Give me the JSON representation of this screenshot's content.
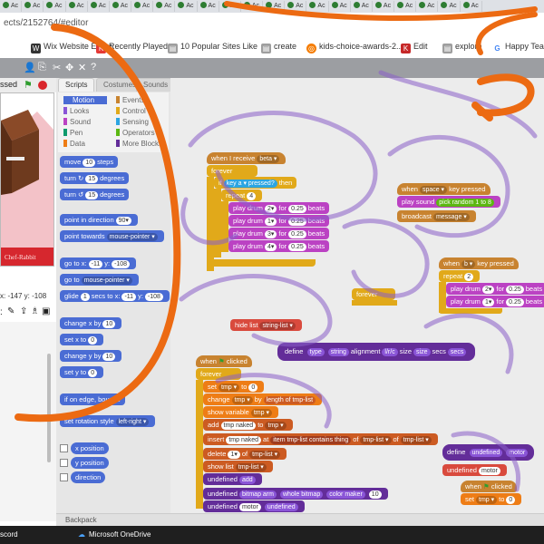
{
  "browser": {
    "tabs": [
      "Ac",
      "Ac",
      "Ac",
      "Ac",
      "Ac",
      "Ac",
      "Ac",
      "Ac",
      "Ac",
      "Ac",
      "Ac",
      "Ac",
      "Ac",
      "Ac",
      "Ac",
      "Ac",
      "Ac",
      "Ac",
      "Ac",
      "Ac",
      "Ac",
      "Ac"
    ],
    "url": "ects/2152764/#editor",
    "bookmarks": [
      "Wix Website Editor",
      "Recently Played »",
      "10 Popular Sites Like",
      "create",
      "kids-choice-awards-2...",
      "Edit",
      "explore",
      "Happy Teach"
    ]
  },
  "stage": {
    "name": "ssed",
    "coords": "x: -147  y: -108"
  },
  "palette": {
    "tabs": [
      "Scripts",
      "Costumes",
      "Sounds"
    ],
    "categories": [
      "Motion",
      "Looks",
      "Sound",
      "Pen",
      "Data",
      "Events",
      "Control",
      "Sensing",
      "Operators",
      "More Blocks"
    ],
    "blocks": {
      "move": "move",
      "move_val": "10",
      "move_tail": "steps",
      "turn_r": "turn ↻",
      "turn_r_val": "15",
      "turn_r_tail": "degrees",
      "turn_l": "turn ↺",
      "turn_l_val": "15",
      "turn_l_tail": "degrees",
      "point_dir": "point in direction",
      "point_dir_val": "90▾",
      "point_towards": "point towards",
      "point_towards_val": "mouse-pointer ▾",
      "goto_xy": "go to x:",
      "goto_xy_x": "-11",
      "goto_xy_y_label": "y:",
      "goto_xy_y": "-108",
      "goto": "go to",
      "goto_val": "mouse-pointer ▾",
      "glide": "glide",
      "glide_secs": "1",
      "glide_mid": "secs to x:",
      "glide_x": "-11",
      "glide_y_label": "y:",
      "glide_y": "-108",
      "change_x": "change x by",
      "change_x_val": "10",
      "set_x": "set x to",
      "set_x_val": "0",
      "change_y": "change y by",
      "change_y_val": "10",
      "set_y": "set y to",
      "set_y_val": "0",
      "bounce": "if on edge, bounce",
      "rot_style": "set rotation style",
      "rot_style_val": "left-right ▾",
      "xpos": "x position",
      "ypos": "y position",
      "direction": "direction"
    },
    "backpack": "Backpack"
  },
  "scripts": {
    "s1": {
      "hat": "when I receive",
      "hat_val": "beta ▾",
      "forever": "forever",
      "if": "if",
      "key": "key",
      "key_val": "a ▾",
      "pressed": "pressed?",
      "then": "then",
      "repeat": "repeat",
      "repeat_val": "4",
      "play": "play drum",
      "for": "for",
      "beats_val": "0.25",
      "beats": "beats",
      "drums": [
        "2▾",
        "1▾",
        "3▾",
        "4▾"
      ]
    },
    "s2": {
      "hat": "when",
      "hat_key": "space ▾",
      "hat_tail": "key pressed",
      "play_sound": "play sound",
      "pick": "pick random",
      "pick_a": "1",
      "pick_to": "to",
      "pick_b": "8",
      "broadcast": "broadcast",
      "broadcast_val": "message ▾"
    },
    "s3": {
      "hat": "when",
      "hat_key": "b ▾",
      "hat_tail": "key pressed",
      "repeat": "repeat",
      "repeat_val": "2",
      "play": "play drum",
      "drums": [
        "2▾",
        "1▾"
      ],
      "for": "for",
      "beats_val": "0.25",
      "beats": "beats"
    },
    "forever_loose": "forever",
    "hide_list": "hide list",
    "hide_list_val": "string-list ▾",
    "define": {
      "define": "define",
      "type": "type",
      "string": "string",
      "alignment": "alignment",
      "lrc": "l/r/c",
      "size": "size",
      "size2": "size",
      "secs": "secs",
      "secs2": "secs"
    },
    "s4": {
      "hat": "when",
      "hat_tail": "clicked",
      "forever": "forever",
      "set": "set",
      "set_var": "tmp ▾",
      "to": "to",
      "set_val": "0",
      "change": "change",
      "change_var": "tmp ▾",
      "by": "by",
      "length": "length of",
      "length_var": "tmp-list",
      "show_var": "show variable",
      "show_var_val": "tmp ▾",
      "add": "add",
      "add_val": "tmp naked",
      "add_to": "to",
      "add_list": "tmp ▾",
      "insert": "insert",
      "insert_val": "tmp naked",
      "at": "at",
      "item": "item",
      "item_list": "tmp-list",
      "contains": "contains",
      "contains_val": "thing",
      "of": "of",
      "of_list": "tmp-list ▾",
      "of2": "of",
      "of2_list": "tmp-list ▾",
      "delete": "delete",
      "delete_val": "1▾",
      "delete_of": "of",
      "delete_list": "tmp-list ▾",
      "show_list": "show list",
      "show_list_val": "tmp-list ▾",
      "undefined_add": "undefined",
      "add2": "add",
      "undefined2": "undefined",
      "bitmap": "bitmap arm",
      "whole": "whole bitmap",
      "color": "color maker",
      "color_val": "10",
      "undefined3": "undefined",
      "undefined3_val": "motor",
      "undefined4": "undefined"
    },
    "s5": {
      "define": "define",
      "undefined": "undefined",
      "motor": "motor",
      "undefined_blk": "undefined",
      "undefined_blk_val": "motor"
    },
    "s6": {
      "hat": "when",
      "hat_tail": "clicked",
      "set": "set",
      "set_var": "tmp ▾",
      "to": "to",
      "set_val": "0"
    }
  },
  "taskbar": {
    "items": [
      "scord",
      "Microsoft OneDrive"
    ]
  },
  "colors": {
    "annotation": "#ec6a12",
    "scribble": "#8a5fc9"
  }
}
